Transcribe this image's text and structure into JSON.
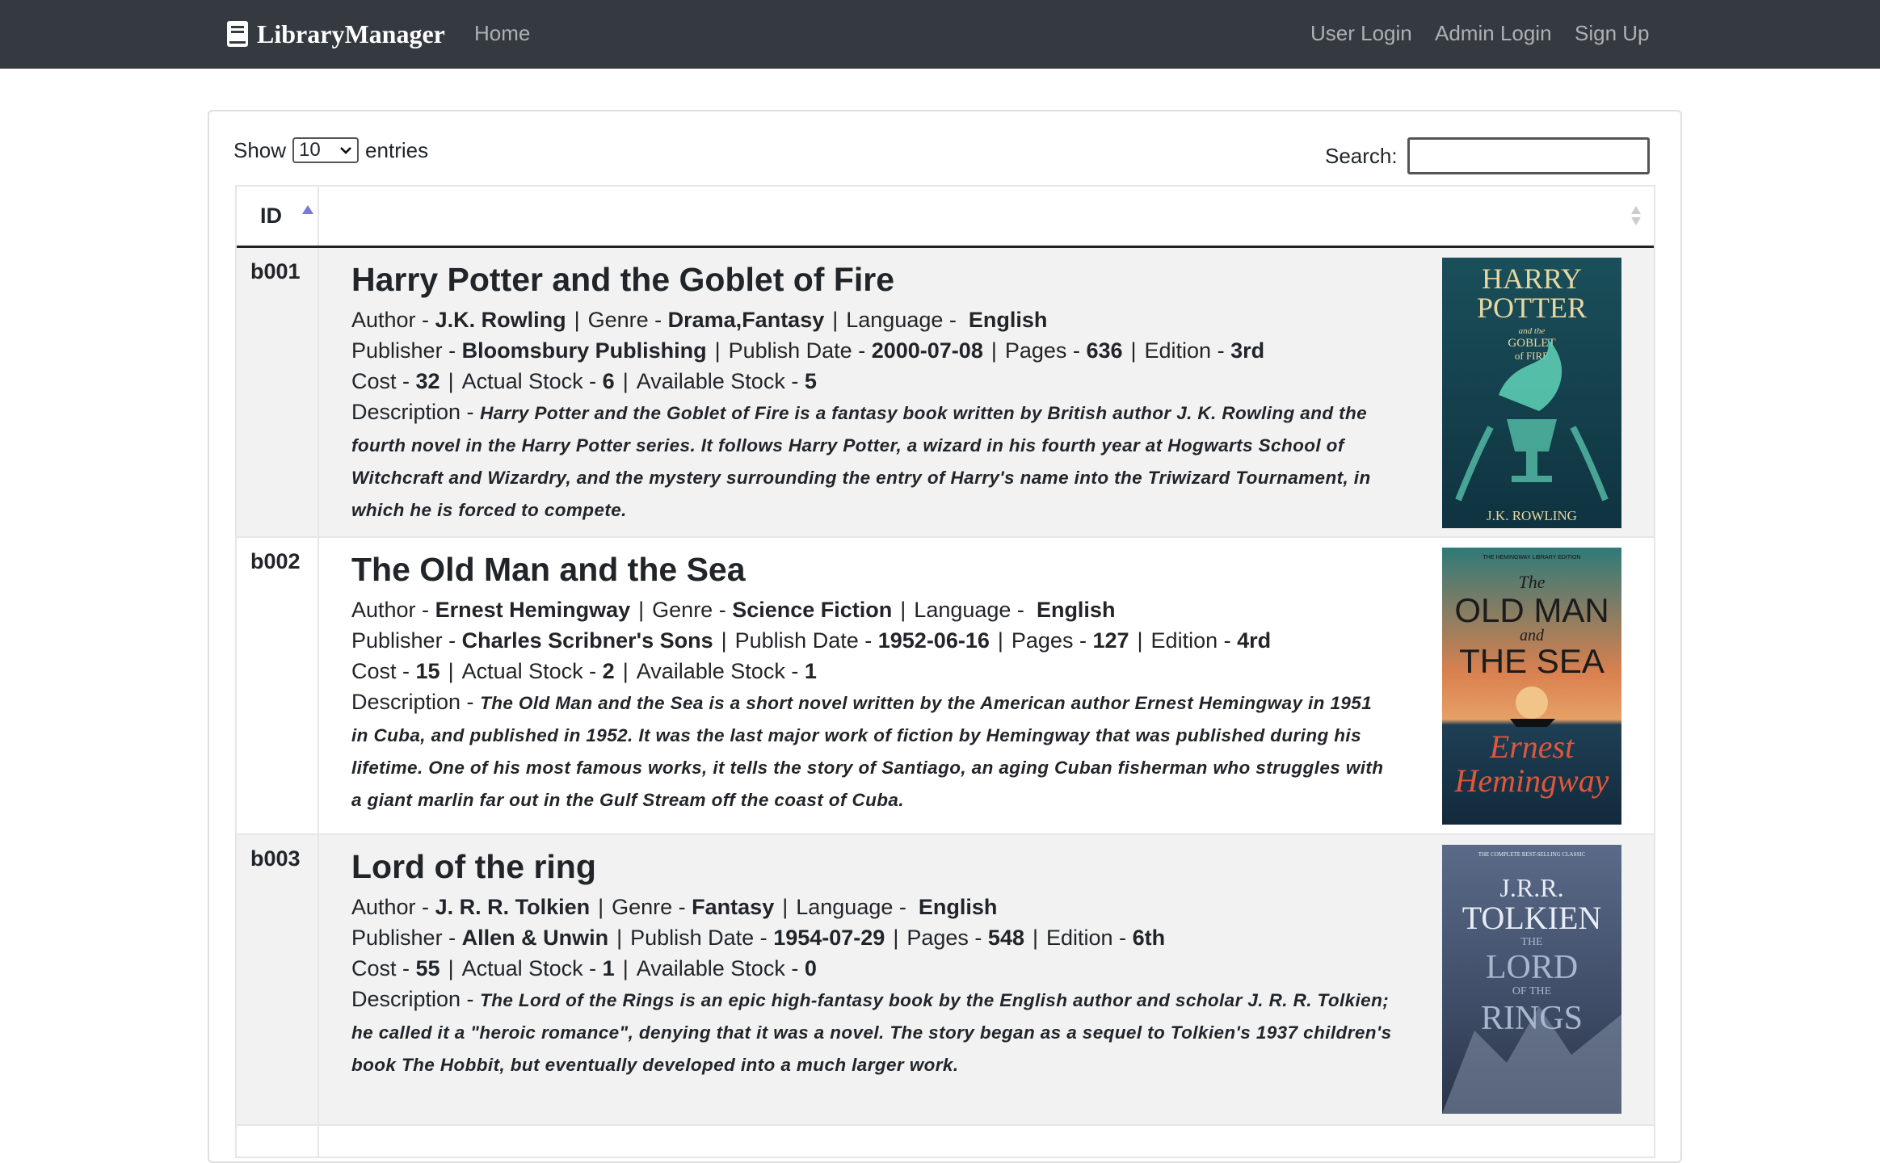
{
  "navbar": {
    "brand": "LibraryManager",
    "home": "Home",
    "user_login": "User Login",
    "admin_login": "Admin Login",
    "sign_up": "Sign Up"
  },
  "table_controls": {
    "show_label": "Show",
    "entries_value": "10",
    "entries_label": "entries",
    "search_label": "Search:",
    "search_value": ""
  },
  "table_header": {
    "id": "ID",
    "details": ""
  },
  "labels": {
    "author": "Author -",
    "genre": "Genre -",
    "language": "Language -",
    "publisher": "Publisher -",
    "publish_date": "Publish Date -",
    "pages": "Pages -",
    "edition": "Edition -",
    "cost": "Cost -",
    "actual_stock": "Actual Stock -",
    "available_stock": "Available Stock -",
    "description": "Description -",
    "sep": "|"
  },
  "books": [
    {
      "id": "b001",
      "title": "Harry Potter and the Goblet of Fire",
      "author": "J.K. Rowling",
      "genre": "Drama,Fantasy",
      "language": "English",
      "publisher": "Bloomsbury Publishing",
      "publish_date": "2000-07-08",
      "pages": "636",
      "edition": "3rd",
      "cost": "32",
      "actual_stock": "6",
      "available_stock": "5",
      "description": "Harry Potter and the Goblet of Fire is a fantasy book written by British author J. K. Rowling and the fourth novel in the Harry Potter series. It follows Harry Potter, a wizard in his fourth year at Hogwarts School of Witchcraft and Wizardry, and the mystery surrounding the entry of Harry's name into the Triwizard Tournament, in which he is forced to compete.",
      "cover": {
        "line1": "HARRY",
        "line2": "POTTER",
        "line3": "and the",
        "line4": "GOBLET",
        "line5": "of FIRE",
        "author": "J.K. ROWLING",
        "bg": "#1c4a52",
        "fg": "#e7d7a1"
      }
    },
    {
      "id": "b002",
      "title": "The Old Man and the Sea",
      "author": "Ernest Hemingway",
      "genre": "Science Fiction",
      "language": "English",
      "publisher": "Charles Scribner's Sons",
      "publish_date": "1952-06-16",
      "pages": "127",
      "edition": "4rd",
      "cost": "15",
      "actual_stock": "2",
      "available_stock": "1",
      "description": "The Old Man and the Sea is a short novel written by the American author Ernest Hemingway in 1951 in Cuba, and published in 1952. It was the last major work of fiction by Hemingway that was published during his lifetime. One of his most famous works, it tells the story of Santiago, an aging Cuban fisherman who struggles with a giant marlin far out in the Gulf Stream off the coast of Cuba.",
      "cover": {
        "top": "THE HEMINGWAY LIBRARY EDITION",
        "line1": "The",
        "line2": "OLD MAN",
        "line3": "and",
        "line4": "THE SEA",
        "author1": "Ernest",
        "author2": "Hemingway",
        "bg": "#2f6b6b",
        "fg": "#1c1c1c"
      }
    },
    {
      "id": "b003",
      "title": "Lord of the ring",
      "author": "J. R. R. Tolkien",
      "genre": "Fantasy",
      "language": "English",
      "publisher": "Allen & Unwin",
      "publish_date": "1954-07-29",
      "pages": "548",
      "edition": "6th",
      "cost": "55",
      "actual_stock": "1",
      "available_stock": "0",
      "description": "The Lord of the Rings is an epic high-fantasy book by the English author and scholar J. R. R. Tolkien; he called it a \"heroic romance\", denying that it was a novel. The story began as a sequel to Tolkien's 1937 children's book The Hobbit, but eventually developed into a much larger work.",
      "cover": {
        "top": "THE COMPLETE BEST-SELLING CLASSIC",
        "author1": "J.R.R.",
        "author2": "TOLKIEN",
        "line1": "THE",
        "line2": "LORD",
        "line3": "OF THE",
        "line4": "RINGS",
        "bg": "#4b5a75",
        "fg": "#e8ecf5"
      }
    }
  ]
}
